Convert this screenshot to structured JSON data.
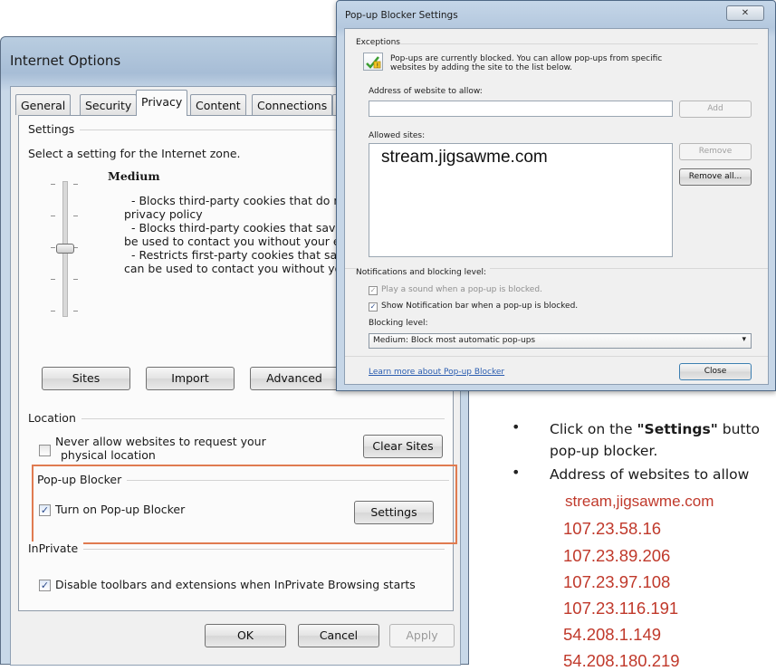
{
  "internet_options": {
    "title": "Internet Options",
    "tabs": [
      "General",
      "Security",
      "Privacy",
      "Content",
      "Connections"
    ],
    "active_tab": "Privacy",
    "settings": {
      "group_label": "Settings",
      "description": "Select a setting for the Internet zone.",
      "level": "Medium",
      "lines": [
        "- Blocks third-party cookies that do not h",
        "privacy policy",
        "- Blocks third-party cookies that save inf",
        "be used to contact you without your exp",
        "- Restricts first-party cookies that save i",
        "can be used to contact you without your"
      ],
      "buttons": {
        "sites": "Sites",
        "import": "Import",
        "advanced": "Advanced"
      }
    },
    "location": {
      "group_label": "Location",
      "checkbox_label_line1": "Never allow websites to request your",
      "checkbox_label_line2": "physical location",
      "clear_sites": "Clear Sites"
    },
    "popup_blocker": {
      "group_label": "Pop-up Blocker",
      "checkbox_label": "Turn on Pop-up Blocker",
      "settings_button": "Settings"
    },
    "inprivate": {
      "group_label": "InPrivate",
      "checkbox_label": "Disable toolbars and extensions when InPrivate Browsing starts"
    },
    "footer": {
      "ok": "OK",
      "cancel": "Cancel",
      "apply": "Apply"
    }
  },
  "popup_settings": {
    "title": "Pop-up Blocker Settings",
    "close_glyph": "✕",
    "exceptions_label": "Exceptions",
    "info_line1": "Pop-ups are currently blocked.  You can allow pop-ups from specific",
    "info_line2": "websites by adding the site to the list below.",
    "address_label": "Address of website to allow:",
    "address_value": "",
    "add_button": "Add",
    "allowed_sites_label": "Allowed sites:",
    "allowed_sites": [
      "stream.jigsawme.com"
    ],
    "remove_button": "Remove",
    "remove_all_button": "Remove all...",
    "notifications_label": "Notifications and blocking level:",
    "play_sound_label": "Play a sound when a pop-up is blocked.",
    "show_bar_label": "Show Notification bar when a pop-up is blocked.",
    "blocking_level_label": "Blocking level:",
    "blocking_level_value": "Medium: Block most automatic pop-ups",
    "learn_more": "Learn more about Pop-up Blocker",
    "close_button": "Close"
  },
  "instructions": {
    "bullet1_prefix": "Click on the ",
    "bullet1_bold": "\"Settings\"",
    "bullet1_suffix": " butto",
    "bullet1_line2": "pop-up blocker.",
    "bullet2": "Address of websites to allow",
    "addresses": [
      "stream,jigsawme.com",
      "107.23.58.16",
      "107.23.89.206",
      "107.23.97.108",
      "107.23.116.191",
      "54.208.1.149",
      "54.208.180.219"
    ]
  },
  "colors": {
    "highlight_box": "#e07b50",
    "address_text": "#c0392b",
    "link": "#2a5db0"
  }
}
